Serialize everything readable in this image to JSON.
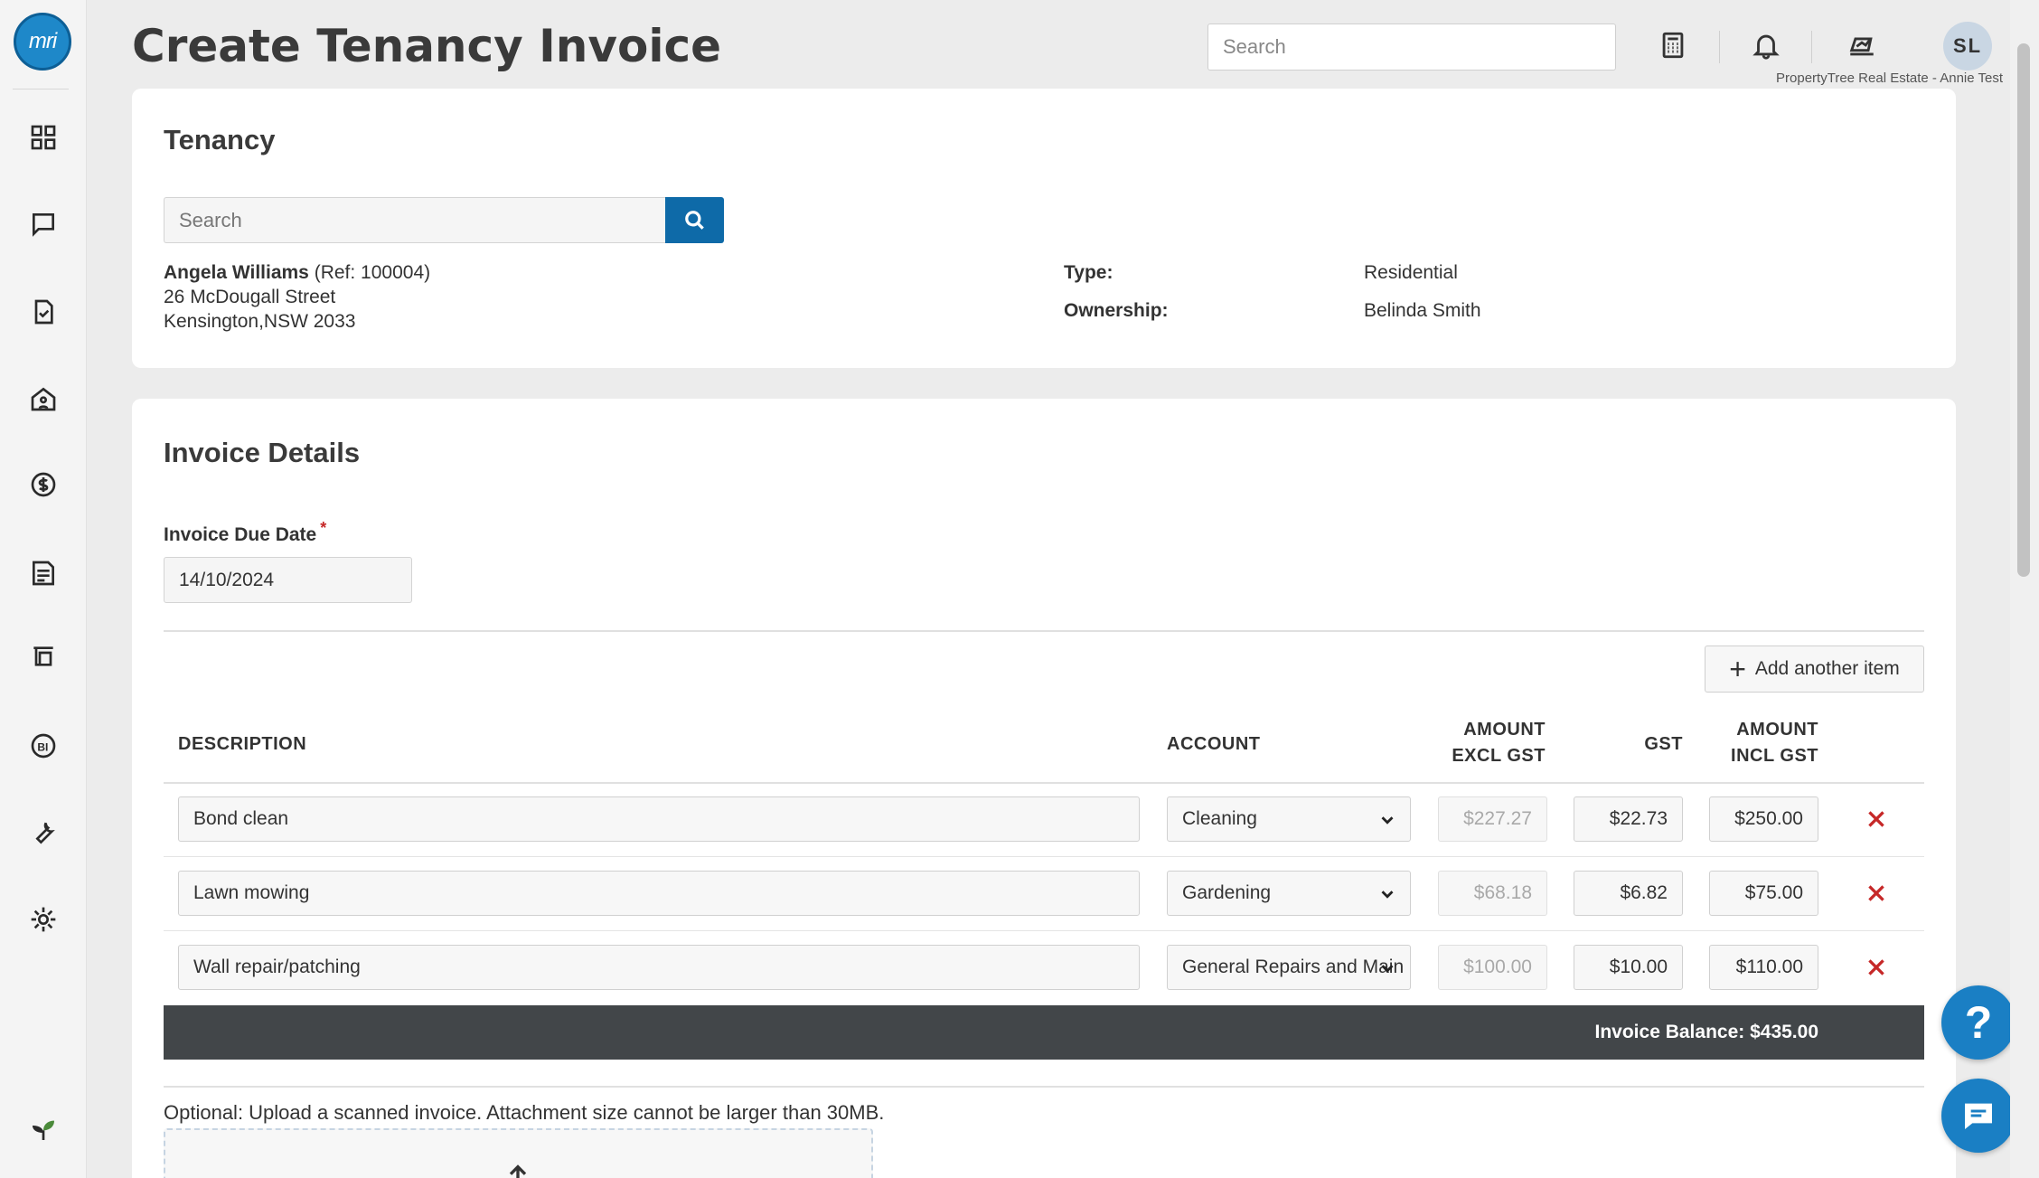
{
  "app": {
    "logo_text": "mri",
    "page_title": "Create Tenancy Invoice",
    "search_placeholder": "Search",
    "user_initials": "SL",
    "agency_name": "PropertyTree Real Estate - Annie Test"
  },
  "sidebar": {
    "items": [
      {
        "icon": "dashboard-icon"
      },
      {
        "icon": "messages-icon"
      },
      {
        "icon": "tasks-icon"
      },
      {
        "icon": "properties-icon"
      },
      {
        "icon": "finance-icon"
      },
      {
        "icon": "reports-icon"
      },
      {
        "icon": "inspections-icon"
      },
      {
        "icon": "bi-icon"
      },
      {
        "icon": "maintenance-icon"
      },
      {
        "icon": "settings-icon"
      },
      {
        "icon": "plant-icon"
      }
    ]
  },
  "tenancy": {
    "title": "Tenancy",
    "search_placeholder": "Search",
    "tenant_name": "Angela Williams",
    "tenant_ref": "(Ref: 100004)",
    "address_line1": "26 McDougall Street",
    "address_line2": "Kensington,NSW 2033",
    "type_label": "Type:",
    "type_value": "Residential",
    "ownership_label": "Ownership:",
    "ownership_value": "Belinda Smith"
  },
  "invoice": {
    "title": "Invoice Details",
    "due_date_label": "Invoice Due Date",
    "required_mark": "*",
    "due_date_value": "14/10/2024",
    "add_item_label": "Add another item",
    "columns": {
      "description": "DESCRIPTION",
      "account": "ACCOUNT",
      "amount_excl_1": "AMOUNT",
      "amount_excl_2": "EXCL GST",
      "gst": "GST",
      "amount_incl_1": "AMOUNT",
      "amount_incl_2": "INCL GST"
    },
    "items": [
      {
        "description": "Bond clean",
        "account": "Cleaning",
        "amount_excl": "$227.27",
        "gst": "$22.73",
        "amount_incl": "$250.00"
      },
      {
        "description": "Lawn mowing",
        "account": "Gardening",
        "amount_excl": "$68.18",
        "gst": "$6.82",
        "amount_incl": "$75.00"
      },
      {
        "description": "Wall repair/patching",
        "account": "General Repairs and Main",
        "amount_excl": "$100.00",
        "gst": "$10.00",
        "amount_incl": "$110.00"
      }
    ],
    "balance_label": "Invoice Balance: $435.00",
    "upload_note": "Optional: Upload a scanned invoice. Attachment size cannot be larger than 30MB."
  },
  "colors": {
    "primary": "#0e6aa8",
    "delete": "#c62828",
    "balance_bar": "#424649"
  }
}
